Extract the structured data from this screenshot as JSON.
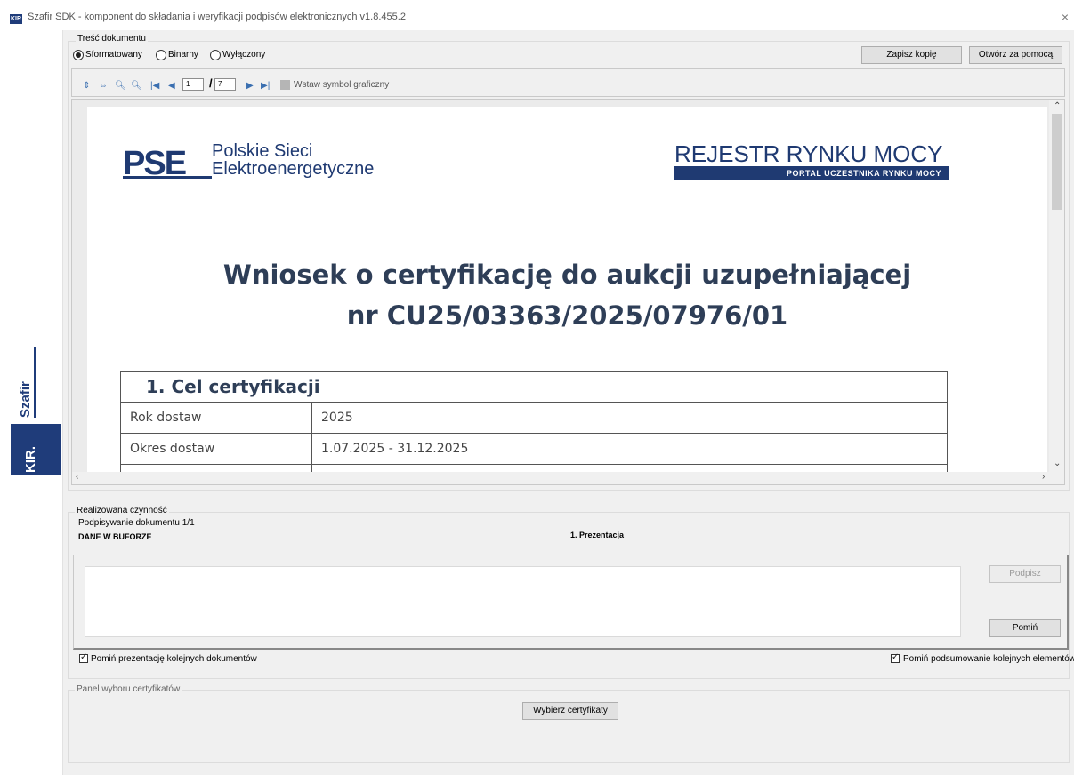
{
  "window": {
    "title": "Szafir SDK - komponent do składania i weryfikacji podpisów elektronicznych v1.8.455.2",
    "app_icon_text": "KIR",
    "close_glyph": "×"
  },
  "brand": {
    "szafir_label": "Szafir",
    "kir_label": "KIR."
  },
  "content_group": {
    "label": "Treść dokumentu",
    "modes": [
      {
        "label": "Sformatowany",
        "selected": true
      },
      {
        "label": "Binarny",
        "selected": false
      },
      {
        "label": "Wyłączony",
        "selected": false
      }
    ],
    "save_copy_label": "Zapisz kopię",
    "open_with_label": "Otwórz za pomocą"
  },
  "toolbar": {
    "current_page": "1",
    "page_separator": "/",
    "total_pages": "7",
    "insert_symbol_label": "Wstaw symbol graficzny"
  },
  "document": {
    "pse_name_line1": "Polskie Sieci",
    "pse_name_line2": "Elektroenergetyczne",
    "registry_title": "REJESTR RYNKU MOCY",
    "registry_subtitle": "PORTAL UCZESTNIKA RYNKU MOCY",
    "title_line1": "Wniosek o certyfikację do aukcji uzupełniającej",
    "title_line2": "nr CU25/03363/2025/07976/01",
    "section_heading": "1. Cel certyfikacji",
    "rows": [
      {
        "label": "Rok dostaw",
        "value": "2025"
      },
      {
        "label": "Okres dostaw",
        "value": "1.07.2025 - 31.12.2025"
      }
    ]
  },
  "activity": {
    "label": "Realizowana czynność",
    "progress": "Podpisywanie dokumentu 1/1",
    "buffer_status": "DANE W BUFORZE",
    "step": "1. Prezentacja",
    "sign_label": "Podpisz",
    "skip_label": "Pomiń",
    "skip_presentation_label": "Pomiń prezentację kolejnych dokumentów",
    "skip_summary_label": "Pomiń podsumowanie kolejnych elementów"
  },
  "certificates": {
    "label": "Panel wyboru certyfikatów",
    "choose_label": "Wybierz certyfikaty"
  },
  "colors": {
    "brand_navy": "#1f3a72",
    "title_slate": "#2e3e57"
  }
}
